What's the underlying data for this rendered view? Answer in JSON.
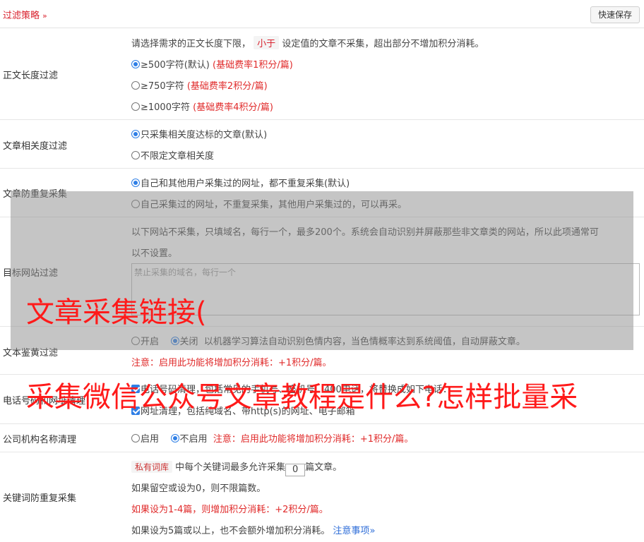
{
  "header": {
    "title": "过滤策略",
    "save_label": "快速保存"
  },
  "length_filter": {
    "label": "正文长度过滤",
    "desc_pre": "请选择需求的正文长度下限，",
    "desc_tag": "小于",
    "desc_post": "设定值的文章不采集，超出部分不增加积分消耗。",
    "options": [
      {
        "text": "≥500字符(默认)",
        "rate": "(基础费率1积分/篇)",
        "checked": true
      },
      {
        "text": "≥750字符",
        "rate": "(基础费率2积分/篇)",
        "checked": false
      },
      {
        "text": "≥1000字符",
        "rate": "(基础费率4积分/篇)",
        "checked": false
      }
    ]
  },
  "relevance_filter": {
    "label": "文章相关度过滤",
    "options": [
      "只采集相关度达标的文章(默认)",
      "不限定文章相关度"
    ]
  },
  "dedup": {
    "label": "文章防重复采集",
    "options": [
      "自己和其他用户采集过的网址，都不重复采集(默认)",
      "自己采集过的网址，不重复采集，其他用户采集过的，可以再采。"
    ]
  },
  "site_filter": {
    "label": "目标网站过滤",
    "desc_line1": "以下网站不采集，只填域名，每行一个，最多200个。系统会自动识别并屏蔽那些非文章类的网站，所以此项通常可",
    "desc_line2": "以不设置。",
    "placeholder": "禁止采集的域名，每行一个"
  },
  "porn_filter": {
    "label": "文本鉴黄过滤",
    "on_label": "开启",
    "off_label": "关闭",
    "desc": "以机器学习算法自动识别色情内容，当色情概率达到系统阈值，自动屏蔽文章。",
    "note": "注意：启用此功能将增加积分消耗：+1积分/篇。"
  },
  "contact_clean": {
    "label": "电话号码和网址清理",
    "phone_text": "电话号码清理，包括常见的手机号、座机号、400电话，将替换成如下电话：",
    "url_text": "网址清理，包括纯域名、带http(s)的网址、电子邮箱"
  },
  "org_clean": {
    "label": "公司机构名称清理",
    "on_label": "启用",
    "off_label": "不启用",
    "note": "注意：启用此功能将增加积分消耗：+1积分/篇。"
  },
  "keyword_dedup": {
    "label": "关键词防重复采集",
    "tag": "私有词库",
    "text_pre": "中每个关键词最多允许采集",
    "count": "0",
    "text_post": "篇文章。",
    "line2": "如果留空或设为0，则不限篇数。",
    "line3": "如果设为1-4篇，则增加积分消耗：+2积分/篇。",
    "line4": "如果设为5篇或以上，也不会额外增加积分消耗。",
    "link": "注意事项"
  },
  "watermark": {
    "line1": "文章采集链接(",
    "line2": "采集微信公众号文章教程是什么?怎样批量采"
  },
  "colors": {
    "accent_red": "#d9232f",
    "link_blue": "#2f6ed8",
    "radio_blue": "#2f7fe6",
    "watermark_red": "#ff1a1a"
  }
}
